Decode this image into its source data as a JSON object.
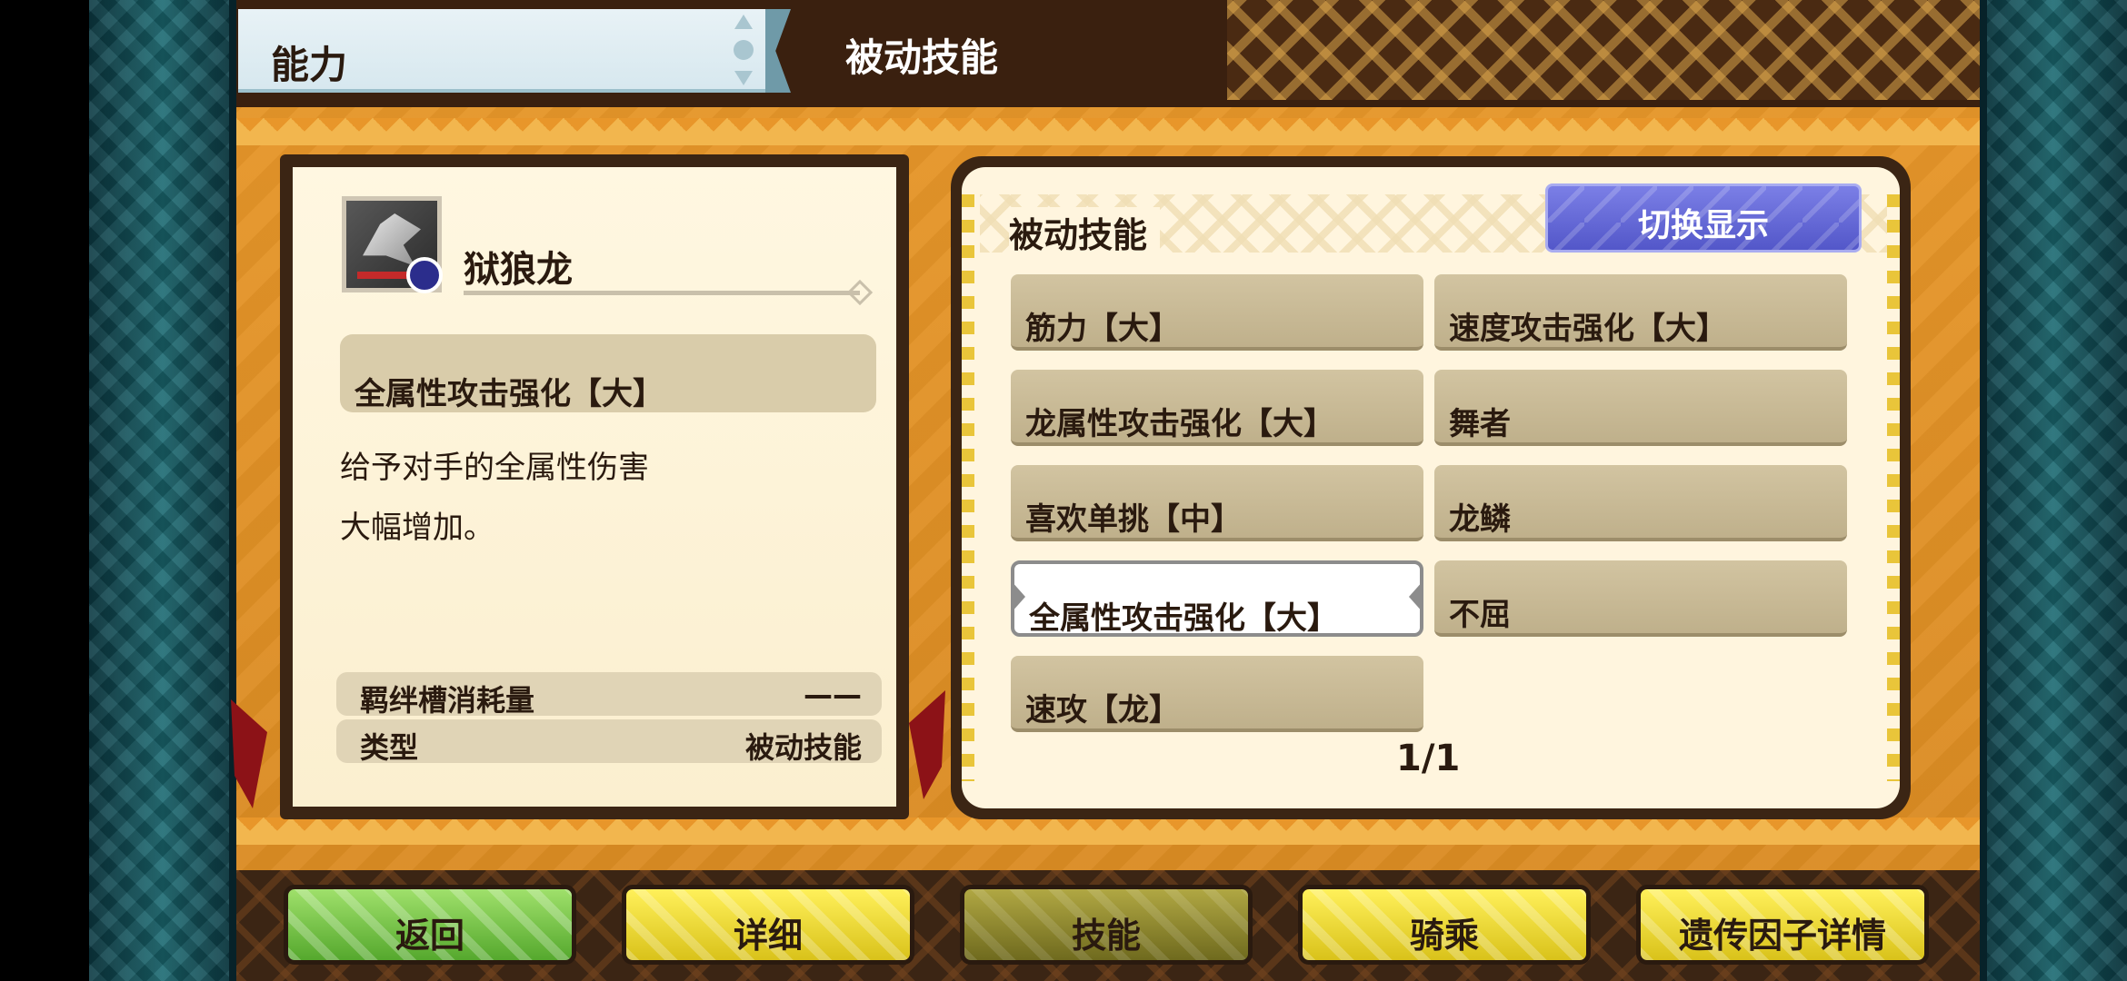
{
  "header": {
    "tab_label": "能力",
    "title": "被动技能"
  },
  "monster": {
    "name": "狱狼龙",
    "icon": "monster-portrait-icon"
  },
  "selected_skill": {
    "name": "全属性攻击强化【大】",
    "description": "给予对手的全属性伤害\n大幅增加。"
  },
  "info": {
    "rows": [
      {
        "key": "羁绊槽消耗量",
        "value": "——"
      },
      {
        "key": "类型",
        "value": "被动技能"
      }
    ]
  },
  "skills_panel": {
    "title": "被动技能",
    "toggle_label": "切换显示",
    "skills": [
      "筋力【大】",
      "速度攻击强化【大】",
      "龙属性攻击强化【大】",
      "舞者",
      "喜欢单挑【中】",
      "龙鳞",
      "全属性攻击强化【大】",
      "不屈",
      "速攻【龙】"
    ],
    "page": "1/1"
  },
  "menu": {
    "back": "返回",
    "details": "详细",
    "skills": "技能",
    "ride": "骑乘",
    "gene_details": "遗传因子详情"
  },
  "colors": {
    "panel_bg": "#fff5de",
    "frame": "#3b2514",
    "accent_blue": "#5357c9",
    "button_green": "#55a82d",
    "button_yellow": "#d9c21a"
  }
}
